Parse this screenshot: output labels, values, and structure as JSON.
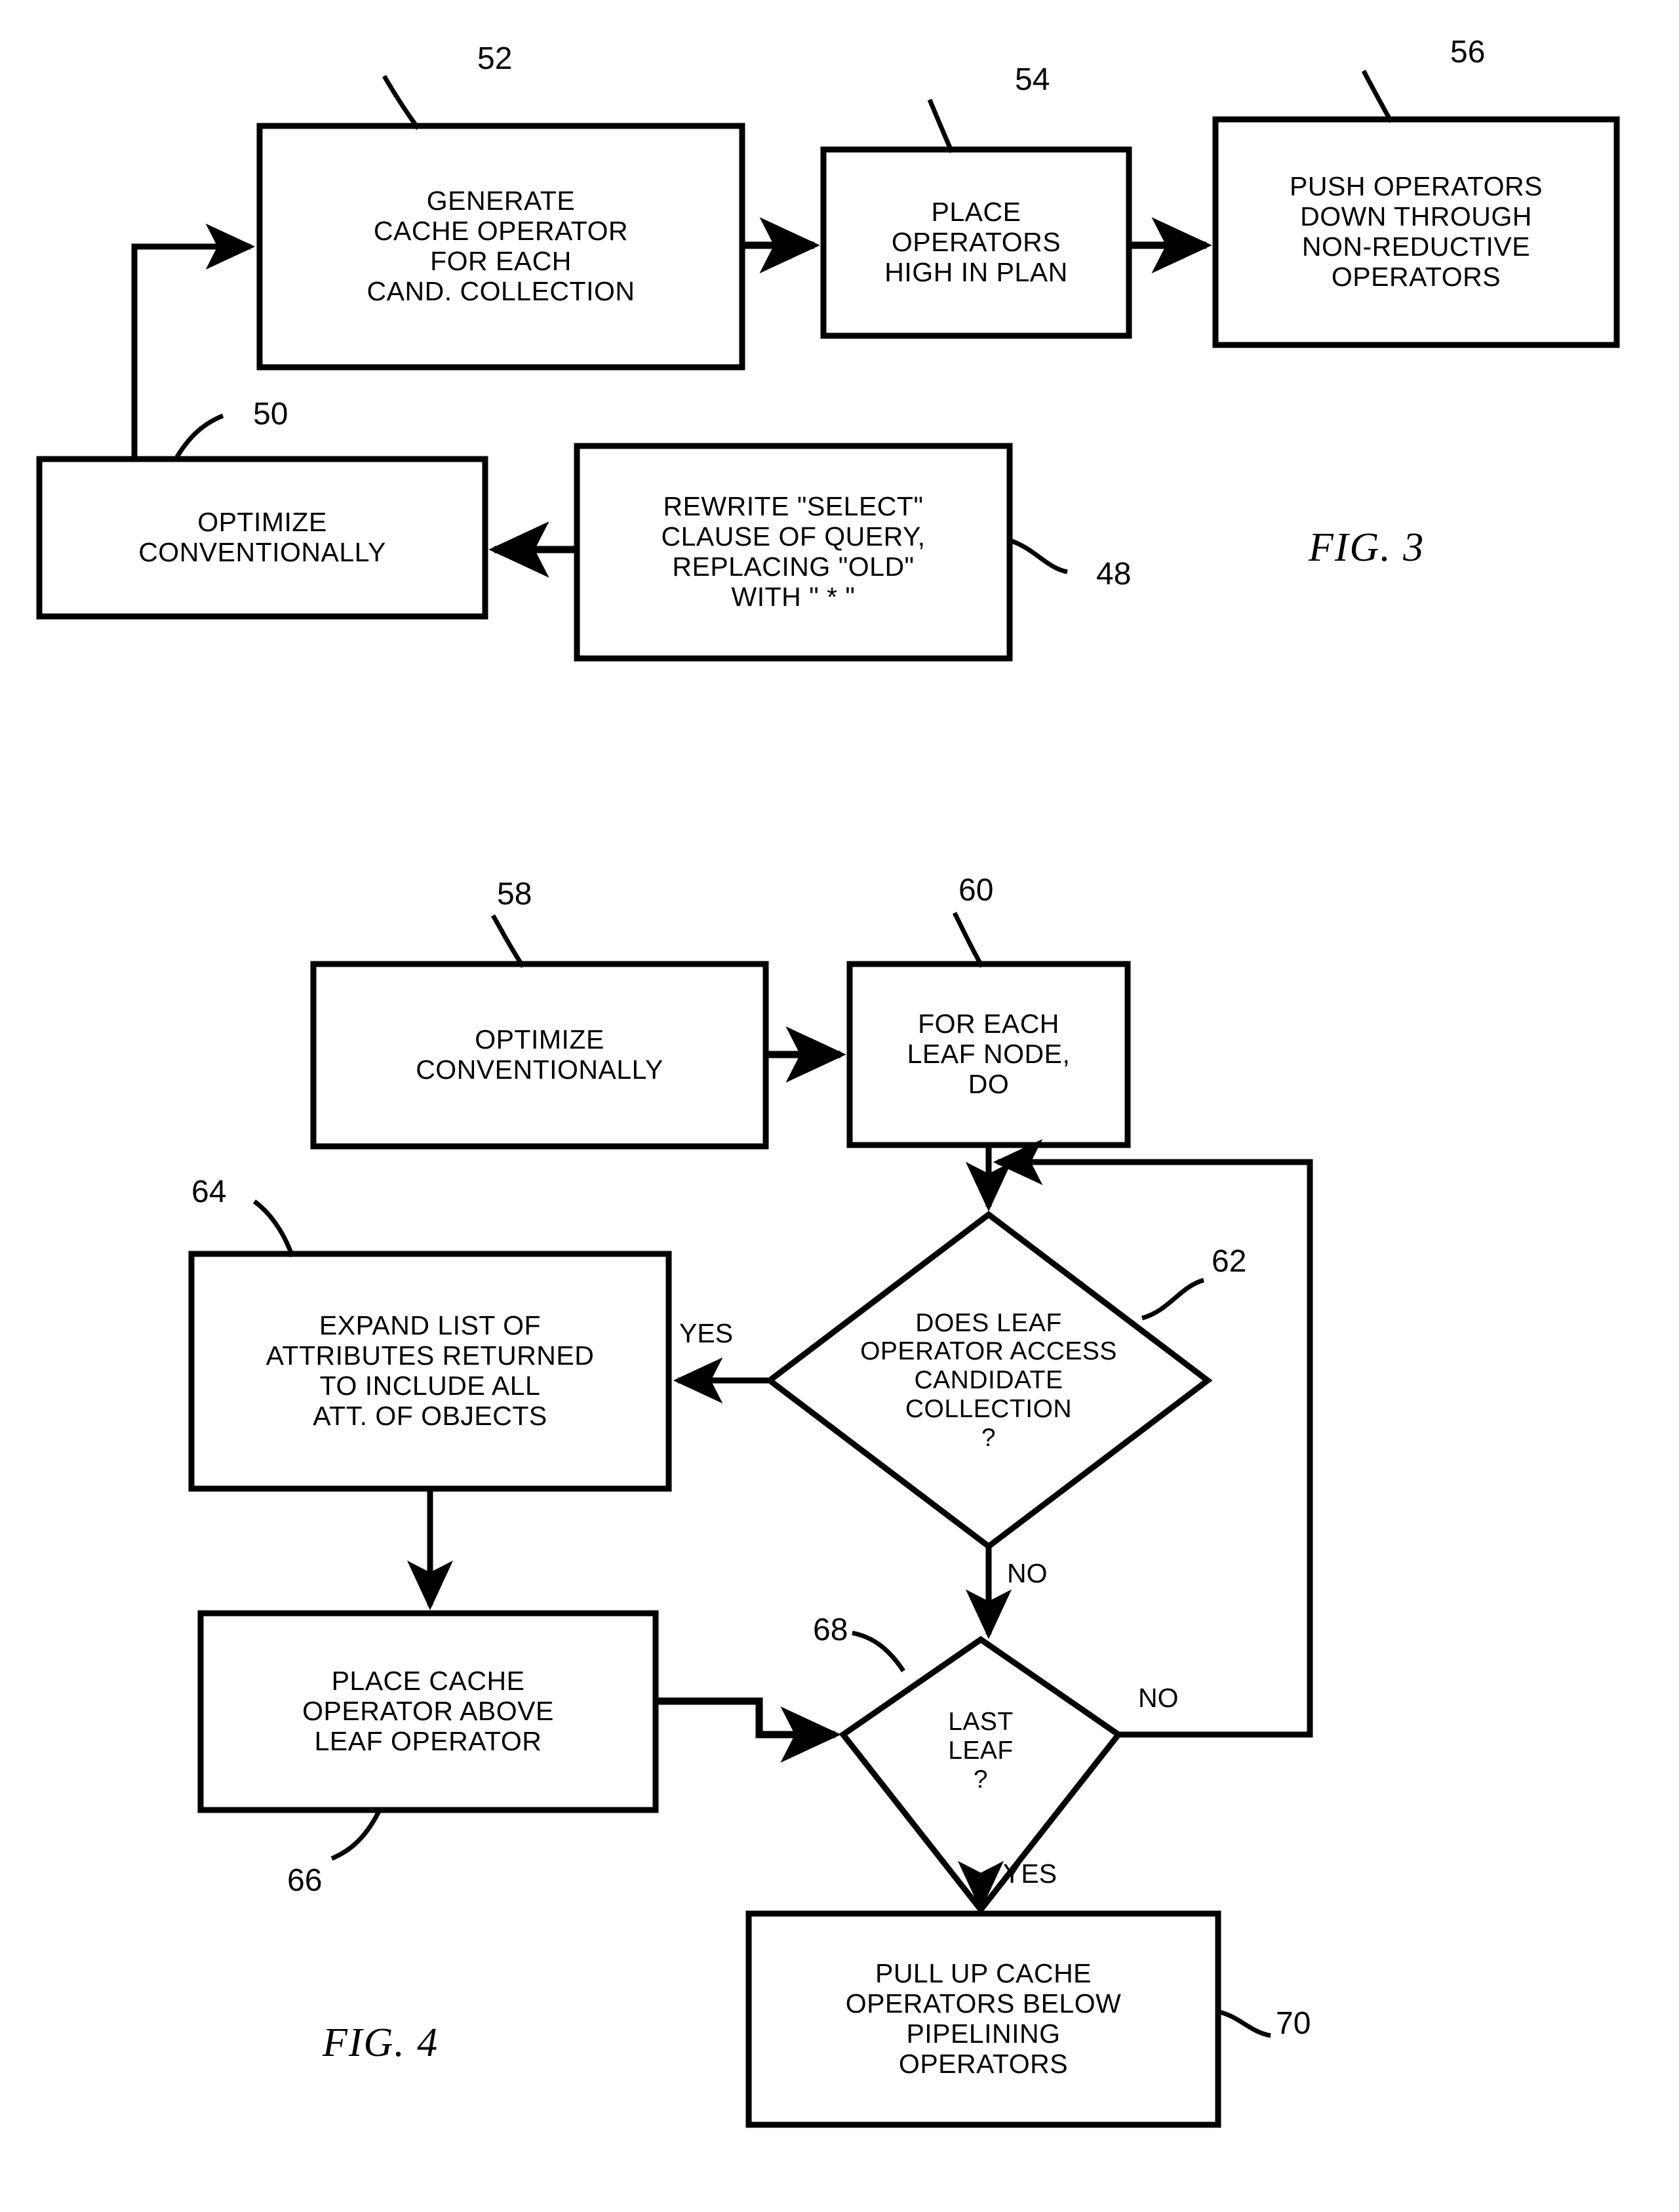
{
  "figures": [
    {
      "id": "fig3",
      "caption": "FIG. 3",
      "nodes": [
        {
          "ref": "52",
          "text": "GENERATE\nCACHE OPERATOR\nFOR EACH\nCAND. COLLECTION",
          "shape": "process"
        },
        {
          "ref": "54",
          "text": "PLACE\nOPERATORS\nHIGH IN PLAN",
          "shape": "process"
        },
        {
          "ref": "56",
          "text": "PUSH OPERATORS\nDOWN THROUGH\nNON-REDUCTIVE\nOPERATORS",
          "shape": "process"
        },
        {
          "ref": "50",
          "text": "OPTIMIZE\nCONVENTIONALLY",
          "shape": "process"
        },
        {
          "ref": "48",
          "text": "REWRITE \"SELECT\"\nCLAUSE OF QUERY,\nREPLACING \"OLD\"\nWITH \" * \"",
          "shape": "process"
        }
      ]
    },
    {
      "id": "fig4",
      "caption": "FIG. 4",
      "nodes": [
        {
          "ref": "58",
          "text": "OPTIMIZE\nCONVENTIONALLY",
          "shape": "process"
        },
        {
          "ref": "60",
          "text": "FOR EACH\nLEAF NODE,\nDO",
          "shape": "process"
        },
        {
          "ref": "62",
          "text": "DOES LEAF\nOPERATOR ACCESS\nCANDIDATE\nCOLLECTION\n?",
          "shape": "decision"
        },
        {
          "ref": "64",
          "text": "EXPAND LIST OF\nATTRIBUTES RETURNED\nTO INCLUDE ALL\nATT. OF OBJECTS",
          "shape": "process"
        },
        {
          "ref": "66",
          "text": "PLACE CACHE\nOPERATOR ABOVE\nLEAF OPERATOR",
          "shape": "process"
        },
        {
          "ref": "68",
          "text": "LAST\nLEAF\n?",
          "shape": "decision"
        },
        {
          "ref": "70",
          "text": "PULL UP CACHE\nOPERATORS BELOW\nPIPELINING\nOPERATORS",
          "shape": "process"
        }
      ],
      "edge_labels": {
        "yes_to_expand": "YES",
        "no_from_62": "NO",
        "no_from_68": "NO",
        "yes_from_68": "YES"
      }
    }
  ],
  "colors": {
    "ink": "#000000",
    "paper": "#ffffff"
  }
}
